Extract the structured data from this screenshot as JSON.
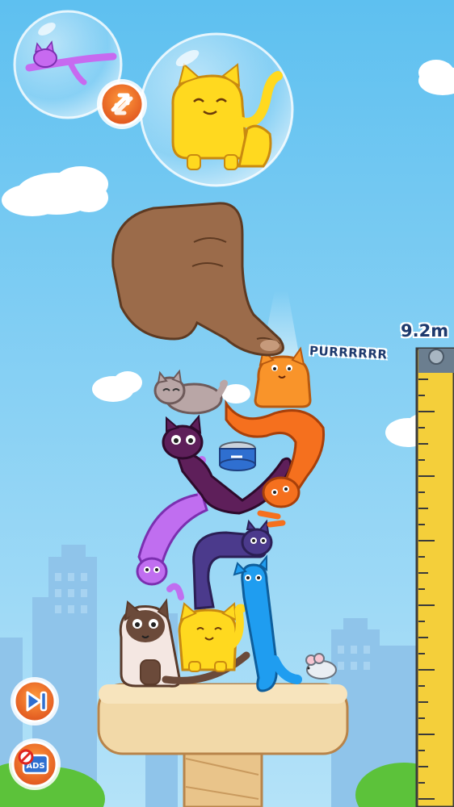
{
  "hud": {
    "tower_height": "9.2m",
    "cat_sound": "PURRRRRR"
  },
  "buttons": {
    "swap_icon": "swap-arrows-icon",
    "skip_icon": "skip-next-icon",
    "no_ads_icon": "no-ads-icon",
    "no_ads_text": "ADS"
  },
  "colors": {
    "sky_top": "#6cc6f2",
    "sky_bottom": "#a9dcf6",
    "ruler": "#f4cf3a",
    "pedestal": "#f2d9a8",
    "text": "#1e3a6e"
  },
  "cats": [
    "purple-cat-preview",
    "yellow-cat-next",
    "orange-cat",
    "grey-cat",
    "dark-purple-cat",
    "violet-cat",
    "indigo-cat",
    "blue-cat",
    "siamese-cat",
    "yellow-cat-bottom"
  ]
}
